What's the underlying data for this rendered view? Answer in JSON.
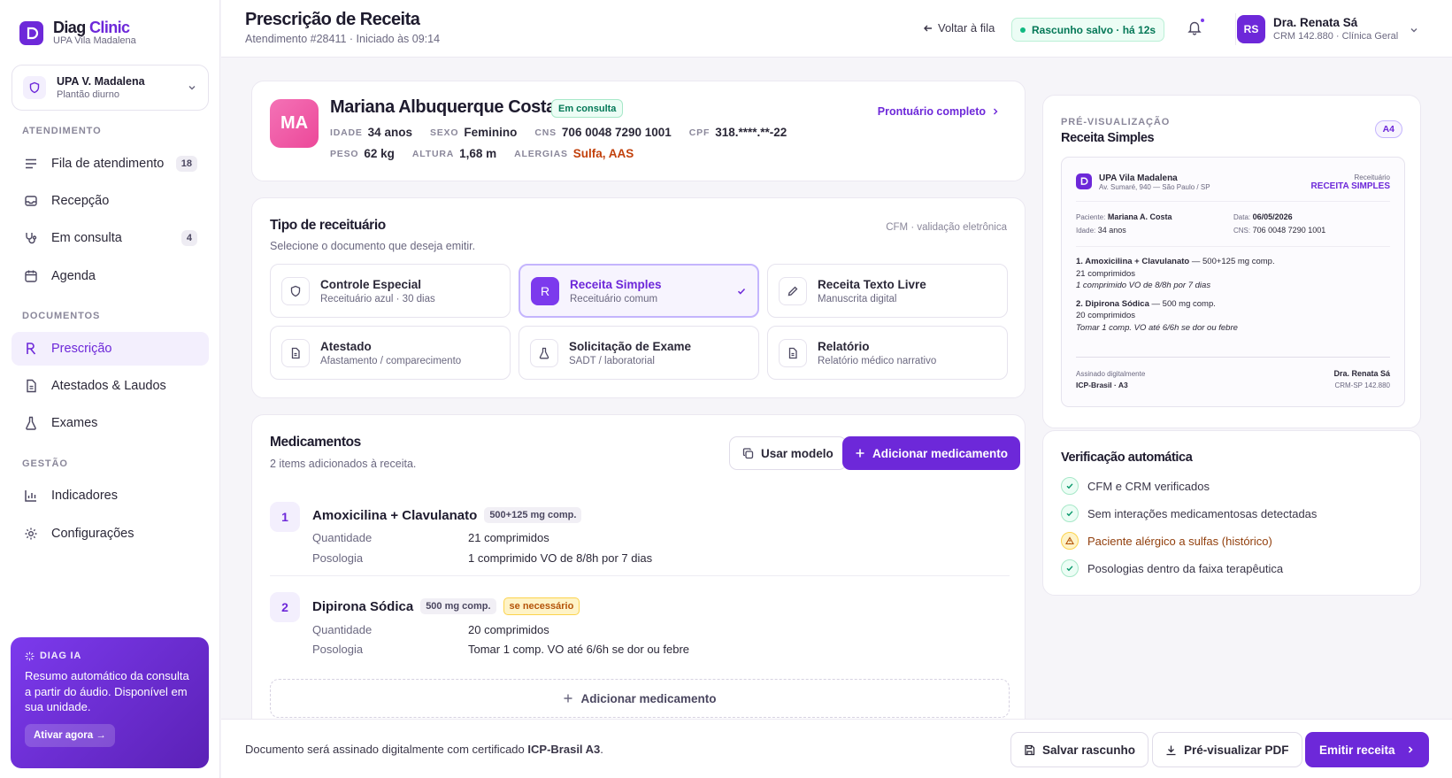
{
  "brand": {
    "name_prefix": "Diag",
    "name_suffix": "Clinic",
    "subtitle": "UPA Vila Madalena"
  },
  "unit": {
    "name": "UPA V. Madalena",
    "shift": "Plantão diurno"
  },
  "nav": {
    "sections": [
      "ATENDIMENTO",
      "DOCUMENTOS",
      "GESTÃO"
    ],
    "items": [
      {
        "label": "Fila de atendimento",
        "badge": "18",
        "icon": "list-icon"
      },
      {
        "label": "Recepção",
        "icon": "inbox-icon"
      },
      {
        "label": "Em consulta",
        "badge": "4",
        "icon": "stethoscope-icon"
      },
      {
        "label": "Agenda",
        "icon": "calendar-icon"
      },
      {
        "label": "Prescrição",
        "icon": "rx-icon",
        "active": true
      },
      {
        "label": "Atestados & Laudos",
        "icon": "document-icon"
      },
      {
        "label": "Exames",
        "icon": "flask-icon"
      },
      {
        "label": "Indicadores",
        "icon": "bar-chart-icon"
      },
      {
        "label": "Configurações",
        "icon": "gear-icon"
      }
    ]
  },
  "ai": {
    "tag": "DIAG IA",
    "text": "Resumo automático da consulta a partir do áudio. Disponível em sua unidade.",
    "cta": "Ativar agora →"
  },
  "header": {
    "title": "Prescrição de Receita",
    "subtitle": "Atendimento #28411 · Iniciado às 09:14",
    "back": "Voltar à fila",
    "draft": "Rascunho salvo · há 12s",
    "user": {
      "initials": "RS",
      "name": "Dra. Renata Sá",
      "sub": "CRM 142.880 · Clínica Geral"
    }
  },
  "patient": {
    "initials": "MA",
    "name": "Mariana Albuquerque Costa",
    "status": "Em consulta",
    "link": "Prontuário completo",
    "fields": {
      "idade_k": "IDADE",
      "idade": "34 anos",
      "sexo_k": "SEXO",
      "sexo": "Feminino",
      "cns_k": "CNS",
      "cns": "706 0048 7290 1001",
      "cpf_k": "CPF",
      "cpf": "318.****.**-22",
      "peso_k": "PESO",
      "peso": "62 kg",
      "altura_k": "ALTURA",
      "altura": "1,68 m",
      "alergias_k": "ALERGIAS",
      "alergias": "Sulfa, AAS"
    }
  },
  "doc_type": {
    "title": "Tipo de receituário",
    "subtitle": "Selecione o documento que deseja emitir.",
    "note": "CFM · validação eletrônica",
    "options": [
      {
        "name": "Controle Especial",
        "sub": "Receituário azul · 30 dias"
      },
      {
        "name": "Receita Simples",
        "sub": "Receituário comum",
        "glyph": "R"
      },
      {
        "name": "Receita Texto Livre",
        "sub": "Manuscrita digital"
      },
      {
        "name": "Atestado",
        "sub": "Afastamento / comparecimento"
      },
      {
        "name": "Solicitação de Exame",
        "sub": "SADT / laboratorial"
      },
      {
        "name": "Relatório",
        "sub": "Relatório médico narrativo"
      }
    ]
  },
  "meds": {
    "title": "Medicamentos",
    "subtitle": "2 items adicionados à receita.",
    "use_template": "Usar modelo",
    "add": "Adicionar medicamento",
    "qty_label": "Quantidade",
    "pos_label": "Posologia",
    "items": [
      {
        "n": "1",
        "name": "Amoxicilina + Clavulanato",
        "dose": "500+125 mg comp.",
        "qty": "21 comprimidos",
        "pos": "1 comprimido VO de 8/8h por 7 dias"
      },
      {
        "n": "2",
        "name": "Dipirona Sódica",
        "dose": "500 mg comp.",
        "flag": "se necessário",
        "qty": "20 comprimidos",
        "pos": "Tomar 1 comp. VO até 6/6h se dor ou febre"
      }
    ],
    "add_bottom": "Adicionar medicamento"
  },
  "preview": {
    "label": "PRÉ-VISUALIZAÇÃO",
    "title": "Receita Simples",
    "size": "A4",
    "unit": "UPA Vila Madalena",
    "address": "Av. Sumaré, 940 — São Paulo / SP",
    "doc_label": "Receituário",
    "doc_type": "RECEITA SIMPLES",
    "patient_k": "Paciente:",
    "patient": "Mariana A. Costa",
    "date_k": "Data:",
    "date": "06/05/2026",
    "age_k": "Idade:",
    "age": "34 anos",
    "cns_k": "CNS:",
    "cns": "706 0048 7290 1001",
    "items": [
      {
        "head": "1. Amoxicilina + Clavulanato",
        "dose": "— 500+125 mg comp.",
        "qty": "21 comprimidos",
        "pos": "1 comprimido VO de 8/8h por 7 dias"
      },
      {
        "head": "2. Dipirona Sódica",
        "dose": "— 500 mg comp.",
        "qty": "20 comprimidos",
        "pos": "Tomar 1 comp. VO até 6/6h se dor ou febre"
      }
    ],
    "signed": "Assinado digitalmente",
    "cert": "ICP-Brasil · A3",
    "doctor": "Dra. Renata Sá",
    "crm": "CRM-SP 142.880"
  },
  "verify": {
    "title": "Verificação automática",
    "items": [
      {
        "text": "CFM e CRM verificados",
        "status": "ok"
      },
      {
        "text": "Sem interações medicamentosas detectadas",
        "status": "ok"
      },
      {
        "text": "Paciente alérgico a sulfas (histórico)",
        "status": "warn"
      },
      {
        "text": "Posologias dentro da faixa terapêutica",
        "status": "ok"
      }
    ]
  },
  "footer": {
    "note_prefix": "Documento será assinado digitalmente com certificado",
    "note_cert": "ICP-Brasil A3",
    "note_suffix": ".",
    "save": "Salvar rascunho",
    "pdf": "Pré-visualizar PDF",
    "emit": "Emitir receita"
  },
  "colors": {
    "accent": "#6d28d9",
    "success": "#047857",
    "warning": "#c2410c"
  }
}
